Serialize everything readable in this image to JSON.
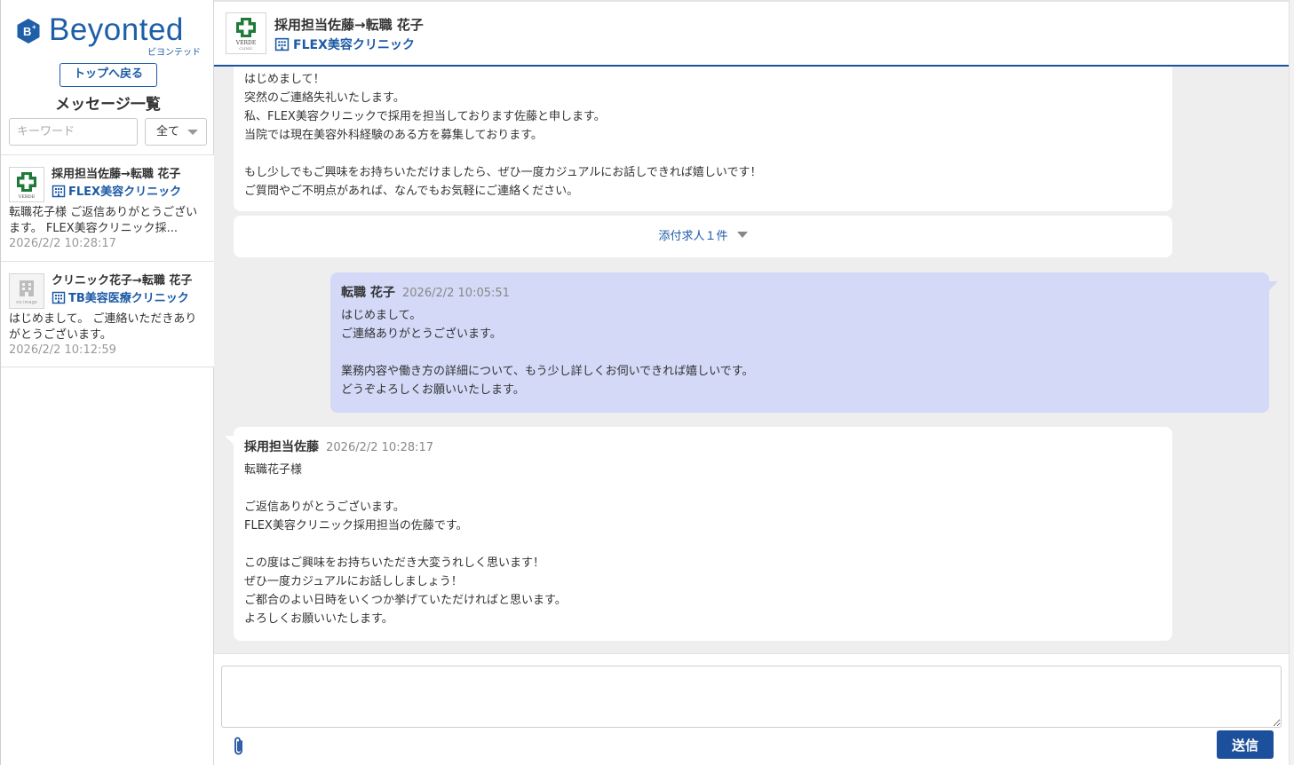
{
  "brand": {
    "name": "Beyonted",
    "kana": "ビヨンテッド",
    "color": "#1e5fa8"
  },
  "sidebar": {
    "back_button": "トップへ戻る",
    "title": "メッセージ一覧",
    "keyword_placeholder": "キーワード",
    "filter_value": "全て",
    "threads": [
      {
        "name": "採用担当佐藤→転職 花子",
        "clinic": "FLEX美容クリニック",
        "avatar_icon": "verde-clinic-logo",
        "avatar_caption": "VERDE",
        "preview": "転職花子様 ご返信ありがとうございます。 FLEX美容クリニック採...",
        "time": "2026/2/2 10:28:17"
      },
      {
        "name": "クリニック花子→転職 花子",
        "clinic": "TB美容医療クリニック",
        "avatar_icon": "no-image-building-icon",
        "avatar_caption": "no image",
        "preview": "はじめまして。 ご連絡いただきありがとうございます。",
        "time": "2026/2/2 10:12:59"
      }
    ]
  },
  "header": {
    "name": "採用担当佐藤→転職 花子",
    "clinic": "FLEX美容クリニック",
    "avatar_caption": "VERDE",
    "avatar_caption_sub": "CLINIC"
  },
  "messages": {
    "first": {
      "lines": [
        "はじめまして！",
        "突然のご連絡失礼いたします。",
        "私、FLEX美容クリニックで採用を担当しております佐藤と申します。",
        "当院では現在美容外科経験のある方を募集しております。",
        "",
        "もし少しでもご興味をお持ちいただけましたら、ぜひ一度カジュアルにお話しできれば嬉しいです！",
        "ご質問やご不明点があれば、なんでもお気軽にご連絡ください。"
      ],
      "attachment": "添付求人１件"
    },
    "reply": {
      "sender": "転職 花子",
      "time": "2026/2/2 10:05:51",
      "lines": [
        "はじめまして。",
        "ご連絡ありがとうございます。",
        "",
        "業務内容や働き方の詳細について、もう少し詳しくお伺いできれば嬉しいです。",
        "どうぞよろしくお願いいたします。"
      ]
    },
    "latest": {
      "sender": "採用担当佐藤",
      "time": "2026/2/2 10:28:17",
      "lines": [
        "転職花子様",
        "",
        "ご返信ありがとうございます。",
        "FLEX美容クリニック採用担当の佐藤です。",
        "",
        "この度はご興味をお持ちいただき大変うれしく思います！",
        "ぜひ一度カジュアルにお話ししましょう！",
        "ご都合のよい日時をいくつか挙げていただければと思います。",
        "よろしくお願いいたします。"
      ]
    }
  },
  "compose": {
    "value": "",
    "send_label": "送信"
  },
  "colors": {
    "accent": "#1c4f9c",
    "link": "#1c5aa6",
    "own_bubble": "#d3d9f7",
    "chat_bg": "#eeeeee",
    "verde_green": "#1f7a3a"
  }
}
